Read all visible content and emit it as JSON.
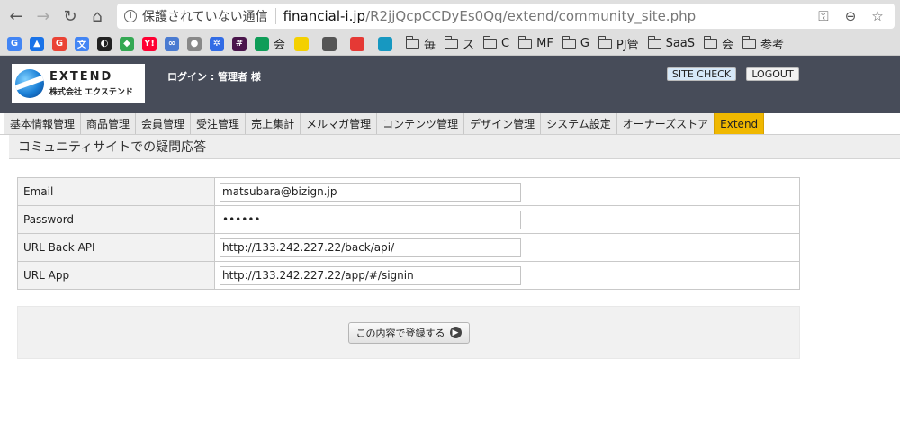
{
  "browser": {
    "insecure_label": "保護されていない通信",
    "url_domain": "financial-i.jp",
    "url_path": "/R2jjQcpCCDyEs0Qq/extend/community_site.php",
    "bookmarks": [
      {
        "icon": "google-icon",
        "color": "#4285f4",
        "glyph": "G"
      },
      {
        "icon": "google-ads-icon",
        "color": "#1a73e8",
        "glyph": "▲"
      },
      {
        "icon": "google-icon",
        "color": "#ea4335",
        "glyph": "G"
      },
      {
        "icon": "translate-icon",
        "color": "#4285f4",
        "glyph": "文"
      },
      {
        "icon": "dark-circle-icon",
        "color": "#222222",
        "glyph": "◐"
      },
      {
        "icon": "maps-icon",
        "color": "#34a853",
        "glyph": "◆"
      },
      {
        "icon": "yahoo-icon",
        "color": "#ff0033",
        "glyph": "Y!"
      },
      {
        "icon": "infinity-icon",
        "color": "#4a7bd1",
        "glyph": "∞"
      },
      {
        "icon": "apple-icon",
        "color": "#888888",
        "glyph": "●"
      },
      {
        "icon": "kubernetes-icon",
        "color": "#326ce5",
        "glyph": "✲"
      },
      {
        "icon": "slack-icon",
        "color": "#4a154b",
        "glyph": "#"
      }
    ],
    "bookmark_items": [
      {
        "label": "会",
        "icon": "hangouts-icon"
      },
      {
        "label": "",
        "icon": "bird-icon"
      },
      {
        "label": "",
        "icon": "mic-icon"
      },
      {
        "label": "",
        "icon": "puzzle-icon"
      },
      {
        "label": "",
        "icon": "salesforce-icon"
      },
      {
        "label": "毎",
        "icon": "folder-icon"
      },
      {
        "label": "ス",
        "icon": "folder-icon"
      },
      {
        "label": "C",
        "icon": "folder-icon"
      },
      {
        "label": "MF",
        "icon": "folder-icon"
      },
      {
        "label": "G",
        "icon": "folder-icon"
      },
      {
        "label": "PJ管",
        "icon": "folder-icon"
      },
      {
        "label": "SaaS",
        "icon": "folder-icon"
      },
      {
        "label": "会",
        "icon": "folder-icon"
      },
      {
        "label": "参考",
        "icon": "folder-icon"
      }
    ]
  },
  "header": {
    "logo_main": "EXTEND",
    "logo_sub": "株式会社 エクステンド",
    "login_text": "ログイン : 管理者 様",
    "site_check_label": "SITE CHECK",
    "logout_label": "LOGOUT"
  },
  "menu": {
    "tabs": [
      {
        "label": "基本情報管理",
        "active": false
      },
      {
        "label": "商品管理",
        "active": false
      },
      {
        "label": "会員管理",
        "active": false
      },
      {
        "label": "受注管理",
        "active": false
      },
      {
        "label": "売上集計",
        "active": false
      },
      {
        "label": "メルマガ管理",
        "active": false
      },
      {
        "label": "コンテンツ管理",
        "active": false
      },
      {
        "label": "デザイン管理",
        "active": false
      },
      {
        "label": "システム設定",
        "active": false
      },
      {
        "label": "オーナーズストア",
        "active": false
      },
      {
        "label": "Extend",
        "active": true
      }
    ]
  },
  "page": {
    "title": "コミュニティサイトでの疑問応答"
  },
  "form": {
    "rows": [
      {
        "label": "Email",
        "value": "matsubara@bizign.jp",
        "type": "text"
      },
      {
        "label": "Password",
        "value": "••••••",
        "type": "password"
      },
      {
        "label": "URL Back API",
        "value": "http://133.242.227.22/back/api/",
        "type": "text"
      },
      {
        "label": "URL App",
        "value": "http://133.242.227.22/app/#/signin",
        "type": "text"
      }
    ],
    "submit_label": "この内容で登録する"
  }
}
